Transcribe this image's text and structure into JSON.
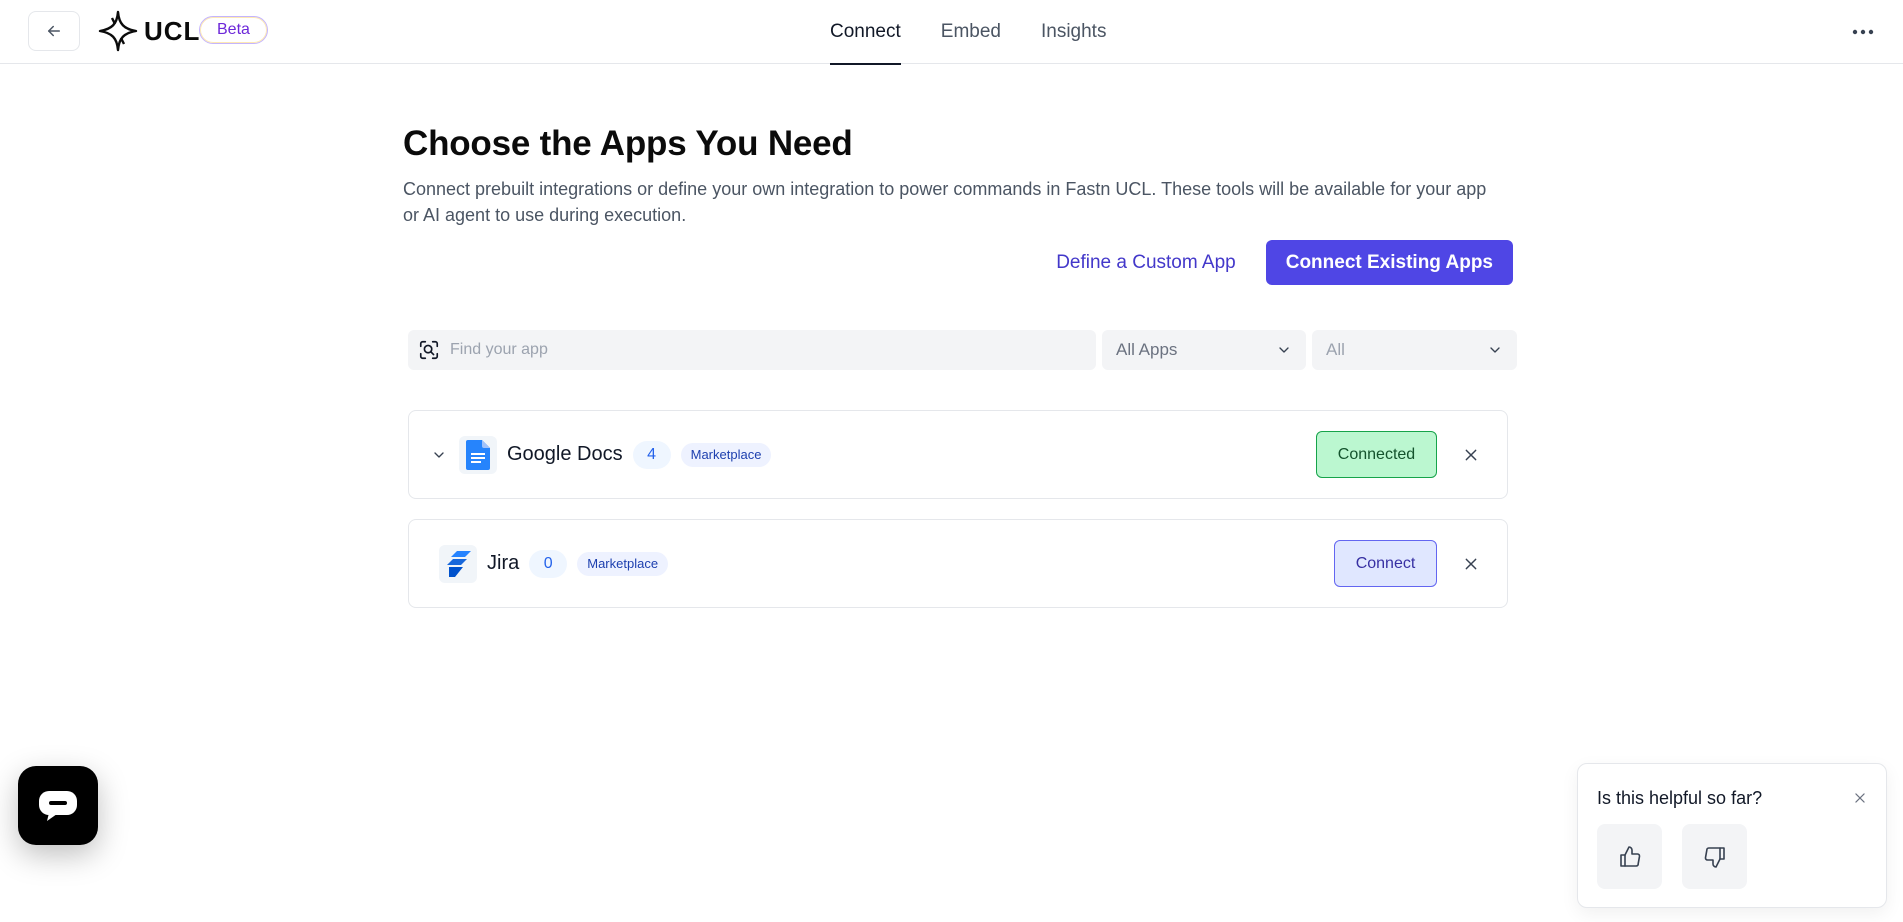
{
  "header": {
    "logo_text": "UCL",
    "beta_label": "Beta",
    "tabs": [
      {
        "label": "Connect",
        "active": true
      },
      {
        "label": "Embed",
        "active": false
      },
      {
        "label": "Insights",
        "active": false
      }
    ],
    "icons": {
      "back": "arrow-left-icon",
      "more": "more-dots-icon",
      "logo": "sparkle-logo-icon"
    }
  },
  "main": {
    "title": "Choose the Apps You Need",
    "description": "Connect prebuilt integrations or define your own integration to power commands in Fastn UCL. These tools will be available for your app or AI agent to use during execution.",
    "define_custom_label": "Define a Custom App",
    "connect_existing_label": "Connect Existing Apps",
    "accent_color": "#4f46e5"
  },
  "filters": {
    "search_placeholder": "Find your app",
    "apps_filter": "All Apps",
    "status_filter": "All"
  },
  "apps": [
    {
      "name": "Google Docs",
      "count": "4",
      "badge": "Marketplace",
      "status": "Connected",
      "icon": "google-docs-icon",
      "expandable": true
    },
    {
      "name": "Jira",
      "count": "0",
      "badge": "Marketplace",
      "status": "Connect",
      "icon": "jira-icon",
      "expandable": false
    }
  ],
  "feedback": {
    "question": "Is this helpful so far?",
    "icons": {
      "up": "thumbs-up-icon",
      "down": "thumbs-down-icon",
      "close": "close-icon"
    }
  },
  "chat": {
    "icon": "chat-icon"
  }
}
